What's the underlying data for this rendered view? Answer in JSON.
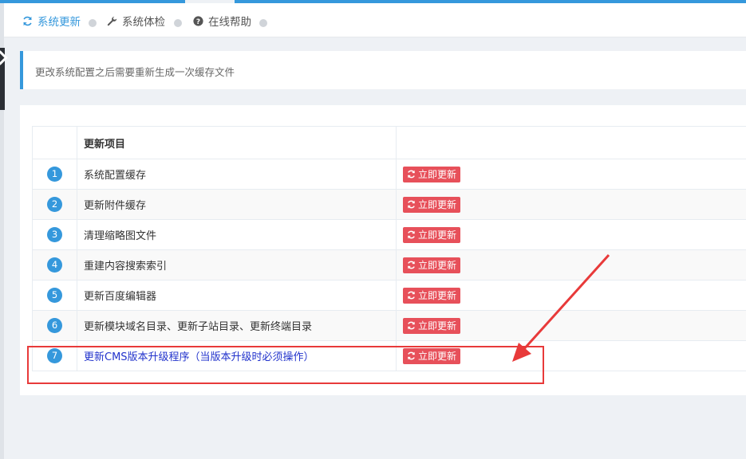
{
  "tabs": [
    {
      "label": "系统更新",
      "icon": "refresh-icon",
      "active": true
    },
    {
      "label": "系统体检",
      "icon": "wrench-icon",
      "active": false
    },
    {
      "label": "在线帮助",
      "icon": "question-circle-icon",
      "active": false
    }
  ],
  "notice": "更改系统配置之后需要重新生成一次缓存文件",
  "table": {
    "header": [
      "",
      "更新项目",
      ""
    ],
    "button_label": "立即更新",
    "rows": [
      {
        "no": "1",
        "name": "系统配置缓存"
      },
      {
        "no": "2",
        "name": "更新附件缓存"
      },
      {
        "no": "3",
        "name": "清理缩略图文件"
      },
      {
        "no": "4",
        "name": "重建内容搜索索引"
      },
      {
        "no": "5",
        "name": "更新百度编辑器"
      },
      {
        "no": "6",
        "name": "更新模块域名目录、更新子站目录、更新终端目录"
      },
      {
        "no": "7",
        "name": "更新CMS版本升级程序（当版本升级时必须操作）"
      }
    ]
  },
  "colors": {
    "accent": "#3598dc",
    "danger": "#e7505a",
    "annotation": "#e83a3a"
  }
}
